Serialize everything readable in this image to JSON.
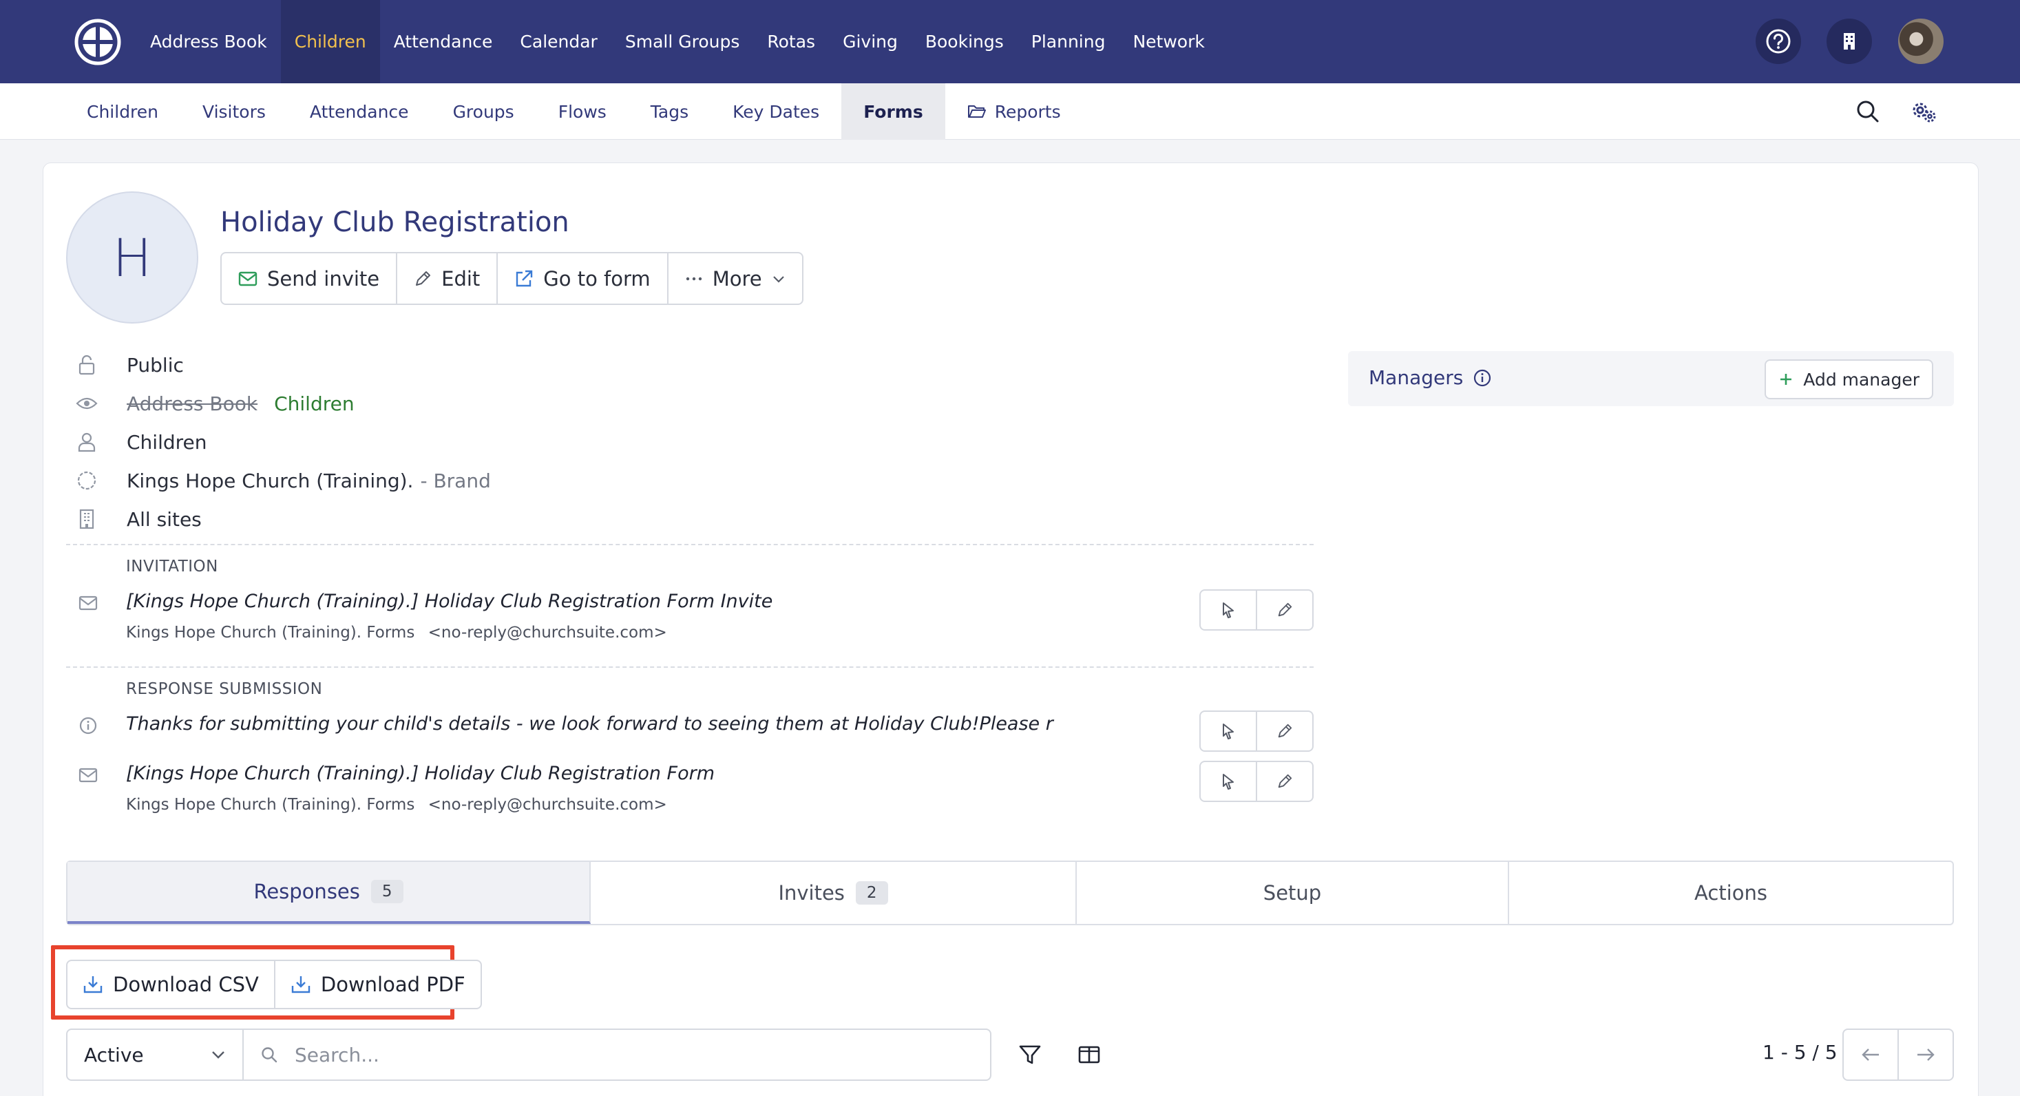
{
  "topnav": {
    "items": [
      {
        "label": "Address Book"
      },
      {
        "label": "Children",
        "active": true
      },
      {
        "label": "Attendance"
      },
      {
        "label": "Calendar"
      },
      {
        "label": "Small Groups"
      },
      {
        "label": "Rotas"
      },
      {
        "label": "Giving"
      },
      {
        "label": "Bookings"
      },
      {
        "label": "Planning"
      },
      {
        "label": "Network"
      }
    ],
    "icons": [
      "help-icon",
      "building-icon",
      "user-avatar"
    ]
  },
  "subnav": {
    "items": [
      {
        "label": "Children"
      },
      {
        "label": "Visitors"
      },
      {
        "label": "Attendance"
      },
      {
        "label": "Groups"
      },
      {
        "label": "Flows"
      },
      {
        "label": "Tags"
      },
      {
        "label": "Key Dates"
      },
      {
        "label": "Forms",
        "active": true
      },
      {
        "label": "Reports",
        "icon": "folder-open-icon"
      }
    ]
  },
  "form": {
    "initial": "H",
    "title": "Holiday Club Registration",
    "actions": {
      "send_invite": "Send invite",
      "edit": "Edit",
      "go_to_form": "Go to form",
      "more": "More"
    }
  },
  "meta": {
    "visibility": "Public",
    "modules_disabled": "Address Book",
    "modules_enabled": "Children",
    "audience": "Children",
    "brand_name": "Kings Hope Church (Training).",
    "brand_suffix": "- Brand",
    "sites": "All sites"
  },
  "invitation": {
    "label": "INVITATION",
    "subject": "[Kings Hope Church (Training).] Holiday Club Registration Form Invite",
    "sender": "Kings Hope Church (Training). Forms",
    "sender_email": "<no-reply@churchsuite.com>"
  },
  "response_submission": {
    "label": "RESPONSE SUBMISSION",
    "message": "Thanks for submitting your child's details - we look forward to seeing them at Holiday Club!Please r",
    "subject": "[Kings Hope Church (Training).] Holiday Club Registration Form",
    "sender": "Kings Hope Church (Training). Forms",
    "sender_email": "<no-reply@churchsuite.com>"
  },
  "managers": {
    "label": "Managers",
    "add_label": "Add manager"
  },
  "tabs": [
    {
      "label": "Responses",
      "count": "5",
      "active": true
    },
    {
      "label": "Invites",
      "count": "2"
    },
    {
      "label": "Setup"
    },
    {
      "label": "Actions"
    }
  ],
  "downloads": {
    "csv": "Download CSV",
    "pdf": "Download PDF"
  },
  "filters": {
    "status_value": "Active",
    "search_placeholder": "Search...",
    "pagination": "1 - 5 / 5"
  },
  "colors": {
    "nav_bg": "#32397a",
    "active_nav_text": "#f2c14e",
    "highlight": "#e8432d",
    "enabled_module": "#2e7d32"
  }
}
